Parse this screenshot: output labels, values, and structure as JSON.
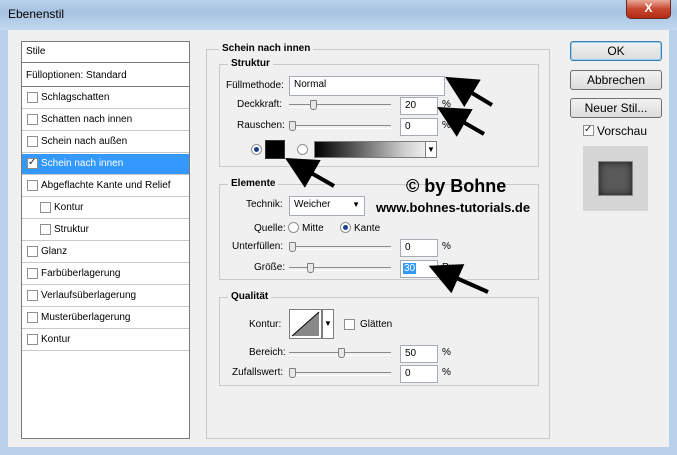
{
  "window": {
    "title": "Ebenenstil",
    "close_glyph": "X"
  },
  "stile": {
    "header": "Stile",
    "fill_options": "Fülloptionen: Standard",
    "items": [
      {
        "label": "Schlagschatten",
        "checked": false
      },
      {
        "label": "Schatten nach innen",
        "checked": false
      },
      {
        "label": "Schein nach außen",
        "checked": false
      },
      {
        "label": "Schein nach innen",
        "checked": true,
        "selected": true
      },
      {
        "label": "Abgeflachte Kante und Relief",
        "checked": false
      },
      {
        "label": "Kontur",
        "checked": false,
        "sub": true
      },
      {
        "label": "Struktur",
        "checked": false,
        "sub": true
      },
      {
        "label": "Glanz",
        "checked": false
      },
      {
        "label": "Farbüberlagerung",
        "checked": false
      },
      {
        "label": "Verlaufsüberlagerung",
        "checked": false
      },
      {
        "label": "Musterüberlagerung",
        "checked": false
      },
      {
        "label": "Kontur",
        "checked": false
      }
    ]
  },
  "panel": {
    "title": "Schein nach innen",
    "struktur": {
      "title": "Struktur",
      "fuellmethode_label": "Füllmethode:",
      "fuellmethode_value": "Normal",
      "deckkraft_label": "Deckkraft:",
      "deckkraft_value": "20",
      "deckkraft_unit": "%",
      "rauschen_label": "Rauschen:",
      "rauschen_value": "0",
      "rauschen_unit": "%"
    },
    "elemente": {
      "title": "Elemente",
      "technik_label": "Technik:",
      "technik_value": "Weicher",
      "quelle_label": "Quelle:",
      "quelle_mitte": "Mitte",
      "quelle_kante": "Kante",
      "unterfuellen_label": "Unterfüllen:",
      "unterfuellen_value": "0",
      "unterfuellen_unit": "%",
      "groesse_label": "Größe:",
      "groesse_value": "30",
      "groesse_unit": "Px"
    },
    "qualitaet": {
      "title": "Qualität",
      "kontur_label": "Kontur:",
      "glaetten_label": "Glätten",
      "bereich_label": "Bereich:",
      "bereich_value": "50",
      "bereich_unit": "%",
      "zufallswert_label": "Zufallswert:",
      "zufallswert_value": "0",
      "zufallswert_unit": "%"
    }
  },
  "buttons": {
    "ok": "OK",
    "abbrechen": "Abbrechen",
    "neuer_stil": "Neuer Stil...",
    "vorschau_label": "Vorschau"
  },
  "watermark": {
    "line1": "© by Bohne",
    "line2": "www.bohnes-tutorials.de"
  },
  "colors": {
    "selection": "#3399ff",
    "glow_color": "#000000"
  }
}
